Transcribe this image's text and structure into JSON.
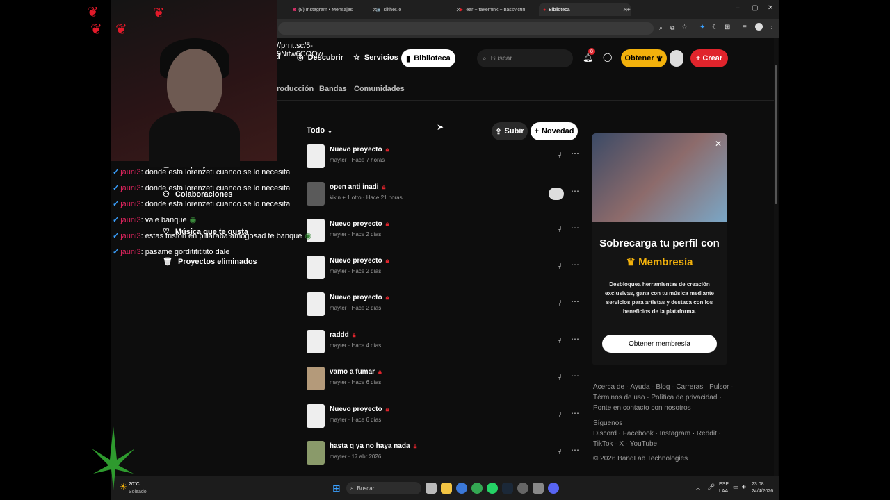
{
  "browser": {
    "tabs": [
      {
        "label": "(8) Instagram • Mensajes",
        "active": false
      },
      {
        "label": "slither.io",
        "active": false
      },
      {
        "label": "ear + fakemink + bassvictim ty...",
        "active": false
      },
      {
        "label": "Biblioteca",
        "active": true
      }
    ],
    "new_tab": "+",
    "window_controls": [
      "–",
      "▢",
      "✕"
    ]
  },
  "overlay": {
    "url_text": "//prnt.sc/5-9Nifw6COQw",
    "chat": [
      {
        "user": "jauni3",
        "text": ": donde esta lorenzeti cuando se lo necesita"
      },
      {
        "user": "jauni3",
        "text": ": donde esta lorenzeti cuando se lo necesita"
      },
      {
        "user": "jauni3",
        "text": ": donde esta lorenzeti cuando se lo necesita"
      },
      {
        "user": "jauni3",
        "text": ": vale banque"
      },
      {
        "user": "jauni3",
        "text": ": estas triston en pillaraba amogosad te banque"
      },
      {
        "user": "jauni3",
        "text": ": pasame gordititititito dale"
      }
    ]
  },
  "nav": {
    "partial": "d",
    "descubrir": "Descubrir",
    "servicios": "Servicios",
    "biblioteca": "Biblioteca",
    "search_placeholder": "Buscar",
    "notif_count": "8",
    "obtener": "Obtener",
    "crear": "Crear"
  },
  "subnav": {
    "produccion": "roducción",
    "bandas": "Bandas",
    "comunidades": "Comunidades"
  },
  "sidebar": {
    "mis_proyectos": "Mis proyectos",
    "colaboraciones": "Colaboraciones",
    "musica": "Música que te gusta",
    "eliminados": "Proyectos eliminados"
  },
  "toolbar": {
    "filter": "Todo",
    "subir": "Subir",
    "novedad": "Novedad"
  },
  "projects": [
    {
      "name": "Nuevo proyecto",
      "author": "mayter",
      "time": "Hace 7 horas"
    },
    {
      "name": "open anti inadi",
      "author": "kikin + 1 otro",
      "time": "Hace 21 horas"
    },
    {
      "name": "Nuevo proyecto",
      "author": "mayter",
      "time": "Hace 2 días"
    },
    {
      "name": "Nuevo proyecto",
      "author": "mayter",
      "time": "Hace 2 días"
    },
    {
      "name": "Nuevo proyecto",
      "author": "mayter",
      "time": "Hace 2 días"
    },
    {
      "name": "raddd",
      "author": "mayter",
      "time": "Hace 4 días"
    },
    {
      "name": "vamo a fumar",
      "author": "mayter",
      "time": "Hace 6 días"
    },
    {
      "name": "Nuevo proyecto",
      "author": "mayter",
      "time": "Hace 6 días"
    },
    {
      "name": "hasta q ya no haya nada",
      "author": "mayter",
      "time": "17 abr 2026"
    }
  ],
  "promo": {
    "title": "Sobrecarga tu perfil con",
    "highlight": "Membresía",
    "description": "Desbloquea herramientas de creación exclusivas, gana con tu música mediante servicios para artistas y destaca con los beneficios de la plataforma.",
    "button": "Obtener membresía"
  },
  "footer": {
    "line1": "Acerca de · Ayuda · Blog · Carreras · Pulsor ·",
    "line2": "Términos de uso · Política de privacidad ·",
    "line3": "Ponte en contacto con nosotros",
    "siguenos": "Síguenos",
    "social1": "Discord · Facebook · Instagram · Reddit ·",
    "social2": "TikTok · X · YouTube",
    "copyright": "© 2026 BandLab Technologies"
  },
  "taskbar": {
    "weather_temp": "20°C",
    "weather_desc": "Soleado",
    "search": "Buscar",
    "lang1": "ESP",
    "lang2": "LAA",
    "time": "23:08",
    "date": "24/4/2026"
  },
  "colors": {
    "accent": "#e0242c",
    "gold": "#f2b10c"
  }
}
